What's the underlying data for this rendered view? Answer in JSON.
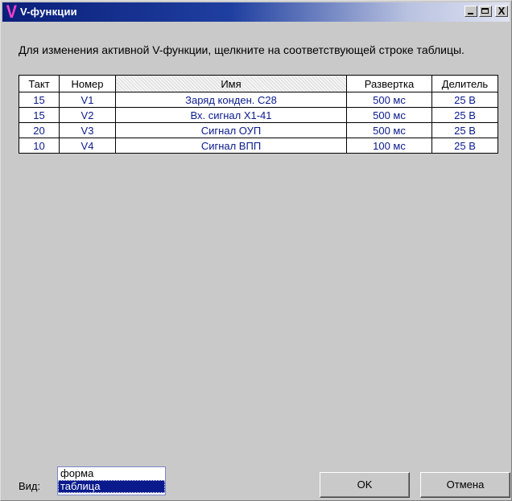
{
  "window": {
    "icon_letter": "V",
    "title": "V-функции",
    "close_glyph": "X"
  },
  "instruction": "Для изменения активной V-функции, щелкните на соответствующей строке таблицы.",
  "table": {
    "columns": [
      "Такт",
      "Номер",
      "Имя",
      "Развертка",
      "Делитель"
    ],
    "rows": [
      [
        "15",
        "V1",
        "Заряд конден. С28",
        "500 мс",
        "25 В"
      ],
      [
        "15",
        "V2",
        "Вх. сигнал Х1-41",
        "500 мс",
        "25 В"
      ],
      [
        "20",
        "V3",
        "Сигнал ОУП",
        "500 мс",
        "25 В"
      ],
      [
        "10",
        "V4",
        "Сигнал ВПП",
        "100 мс",
        "25 В"
      ]
    ]
  },
  "view": {
    "label": "Вид:",
    "options": [
      "форма",
      "таблица"
    ],
    "selected": "таблица"
  },
  "buttons": {
    "ok": "OK",
    "cancel": "Отмена"
  },
  "colors": {
    "title_bar_start": "#0a1f7a",
    "cell_text": "#0a1a8c",
    "window_bg": "#c9c9c9"
  }
}
